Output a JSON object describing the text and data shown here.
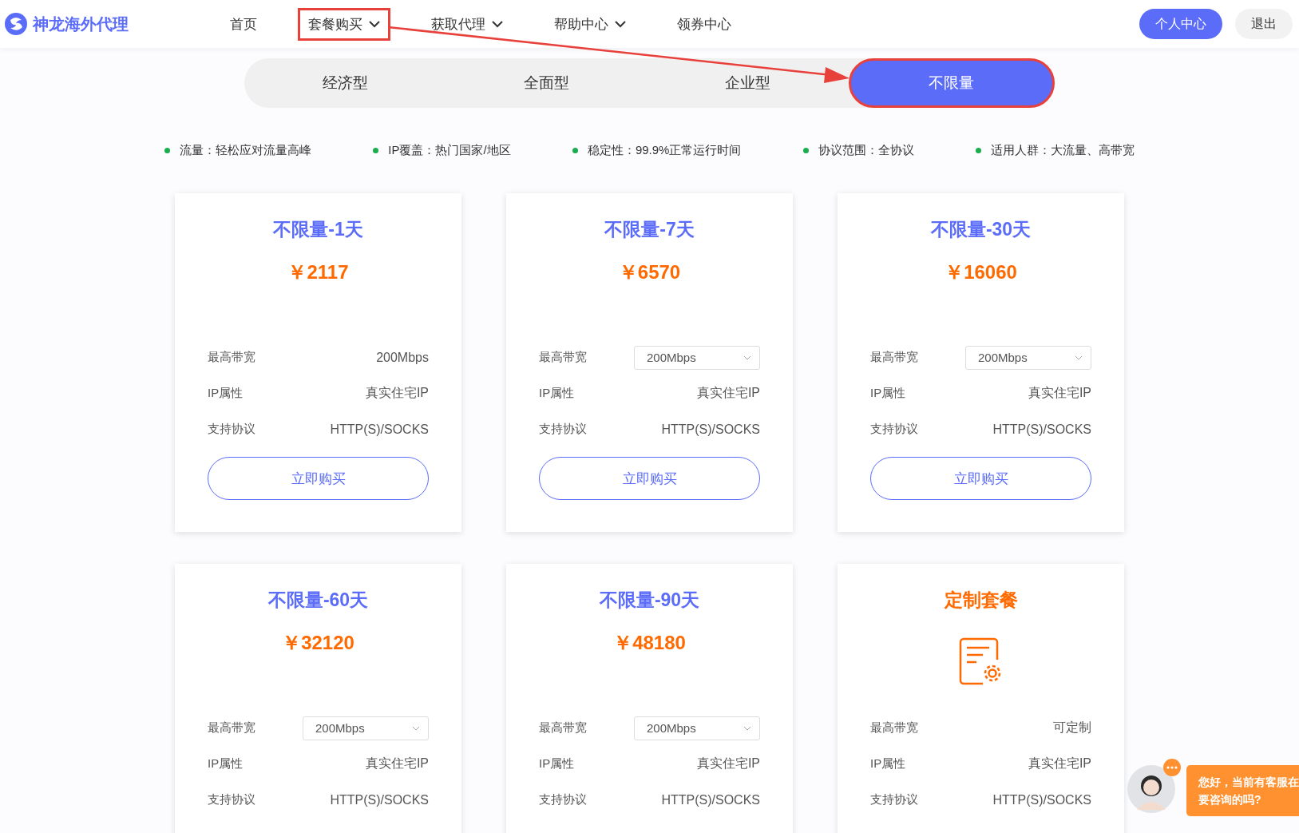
{
  "header": {
    "logo": "神龙海外代理",
    "nav": [
      {
        "label": "首页",
        "has_menu": false,
        "annotated": false
      },
      {
        "label": "套餐购买",
        "has_menu": true,
        "annotated": true
      },
      {
        "label": "获取代理",
        "has_menu": true,
        "annotated": false
      },
      {
        "label": "帮助中心",
        "has_menu": true,
        "annotated": false
      },
      {
        "label": "领券中心",
        "has_menu": false,
        "annotated": false
      }
    ],
    "buttons": [
      {
        "label": "个人中心",
        "kind": "primary"
      },
      {
        "label": "退出",
        "kind": "plain"
      }
    ]
  },
  "tabs": [
    {
      "label": "经济型",
      "selected": false,
      "annotated": false
    },
    {
      "label": "全面型",
      "selected": false,
      "annotated": false
    },
    {
      "label": "企业型",
      "selected": false,
      "annotated": false
    },
    {
      "label": "不限量",
      "selected": true,
      "annotated": true
    }
  ],
  "features": [
    "流量：轻松应对流量高峰",
    "IP覆盖：热门国家/地区",
    "稳定性：99.9%正常运行时间",
    "协议范围：全协议",
    "适用人群：大流量、高带宽"
  ],
  "cards": [
    {
      "kind": "plan",
      "title": "不限量-1天",
      "price": "￥2117",
      "specs": [
        {
          "label": "最高带宽",
          "value": "200Mbps",
          "kind": "text"
        },
        {
          "label": "IP属性",
          "value": "真实住宅IP",
          "kind": "text"
        },
        {
          "label": "支持协议",
          "value": "HTTP(S)/SOCKS",
          "kind": "text"
        }
      ],
      "button": "立即购买"
    },
    {
      "kind": "plan",
      "title": "不限量-7天",
      "price": "￥6570",
      "specs": [
        {
          "label": "最高带宽",
          "value": "200Mbps",
          "kind": "select"
        },
        {
          "label": "IP属性",
          "value": "真实住宅IP",
          "kind": "text"
        },
        {
          "label": "支持协议",
          "value": "HTTP(S)/SOCKS",
          "kind": "text"
        }
      ],
      "button": "立即购买"
    },
    {
      "kind": "plan",
      "title": "不限量-30天",
      "price": "￥16060",
      "specs": [
        {
          "label": "最高带宽",
          "value": "200Mbps",
          "kind": "select"
        },
        {
          "label": "IP属性",
          "value": "真实住宅IP",
          "kind": "text"
        },
        {
          "label": "支持协议",
          "value": "HTTP(S)/SOCKS",
          "kind": "text"
        }
      ],
      "button": "立即购买"
    },
    {
      "kind": "plan",
      "title": "不限量-60天",
      "price": "￥32120",
      "specs": [
        {
          "label": "最高带宽",
          "value": "200Mbps",
          "kind": "select"
        },
        {
          "label": "IP属性",
          "value": "真实住宅IP",
          "kind": "text"
        },
        {
          "label": "支持协议",
          "value": "HTTP(S)/SOCKS",
          "kind": "text"
        }
      ]
    },
    {
      "kind": "plan",
      "title": "不限量-90天",
      "price": "￥48180",
      "specs": [
        {
          "label": "最高带宽",
          "value": "200Mbps",
          "kind": "select"
        },
        {
          "label": "IP属性",
          "value": "真实住宅IP",
          "kind": "text"
        },
        {
          "label": "支持协议",
          "value": "HTTP(S)/SOCKS",
          "kind": "text"
        }
      ]
    },
    {
      "kind": "custom",
      "title": "定制套餐",
      "specs": [
        {
          "label": "最高带宽",
          "value": "可定制",
          "kind": "text"
        },
        {
          "label": "IP属性",
          "value": "真实住宅IP",
          "kind": "text"
        },
        {
          "label": "支持协议",
          "value": "HTTP(S)/SOCKS",
          "kind": "text"
        }
      ]
    }
  ],
  "chat": {
    "message": "您好，当前有客服在",
    "message_2": "要咨询的吗?"
  }
}
